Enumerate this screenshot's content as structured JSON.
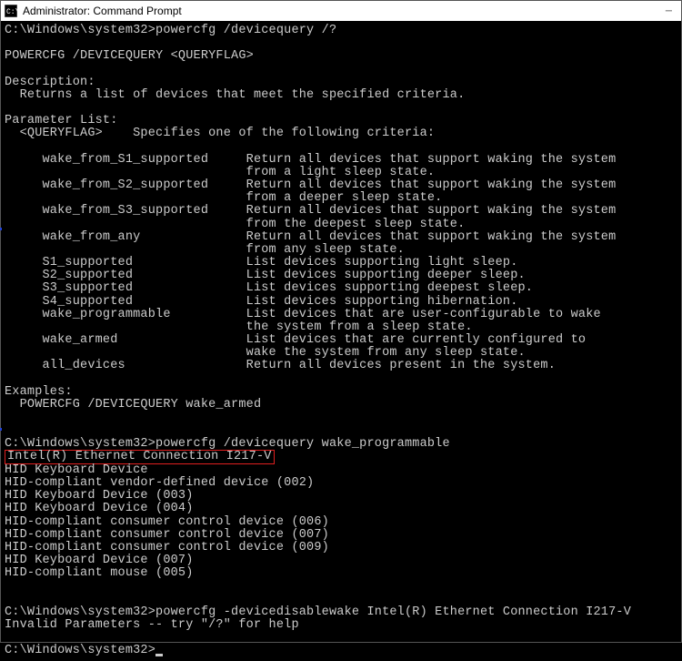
{
  "window": {
    "title": "Administrator: Command Prompt"
  },
  "terminal": {
    "prompt1_path": "C:\\Windows\\system32>",
    "prompt1_cmd": "powercfg /devicequery /?",
    "usage": "POWERCFG /DEVICEQUERY <QUERYFLAG>",
    "desc_header": "Description:",
    "desc_body": "  Returns a list of devices that meet the specified criteria.",
    "param_header": "Parameter List:",
    "param_intro": "  <QUERYFLAG>    Specifies one of the following criteria:",
    "flags": [
      {
        "name": "     wake_from_S1_supported",
        "desc1": "Return all devices that support waking the system",
        "desc2": "from a light sleep state."
      },
      {
        "name": "     wake_from_S2_supported",
        "desc1": "Return all devices that support waking the system",
        "desc2": "from a deeper sleep state."
      },
      {
        "name": "     wake_from_S3_supported",
        "desc1": "Return all devices that support waking the system",
        "desc2": "from the deepest sleep state."
      },
      {
        "name": "     wake_from_any",
        "desc1": "Return all devices that support waking the system",
        "desc2": "from any sleep state."
      },
      {
        "name": "     S1_supported",
        "desc1": "List devices supporting light sleep.",
        "desc2": ""
      },
      {
        "name": "     S2_supported",
        "desc1": "List devices supporting deeper sleep.",
        "desc2": ""
      },
      {
        "name": "     S3_supported",
        "desc1": "List devices supporting deepest sleep.",
        "desc2": ""
      },
      {
        "name": "     S4_supported",
        "desc1": "List devices supporting hibernation.",
        "desc2": ""
      },
      {
        "name": "     wake_programmable",
        "desc1": "List devices that are user-configurable to wake",
        "desc2": "the system from a sleep state."
      },
      {
        "name": "     wake_armed",
        "desc1": "List devices that are currently configured to",
        "desc2": "wake the system from any sleep state."
      },
      {
        "name": "     all_devices",
        "desc1": "Return all devices present in the system.",
        "desc2": ""
      }
    ],
    "examples_header": "Examples:",
    "examples_body": "  POWERCFG /DEVICEQUERY wake_armed",
    "prompt2_path": "C:\\Windows\\system32>",
    "prompt2_cmd": "powercfg /devicequery wake_programmable",
    "highlighted_device": "Intel(R) Ethernet Connection I217-V",
    "devices": [
      "HID Keyboard Device",
      "HID-compliant vendor-defined device (002)",
      "HID Keyboard Device (003)",
      "HID Keyboard Device (004)",
      "HID-compliant consumer control device (006)",
      "HID-compliant consumer control device (007)",
      "HID-compliant consumer control device (009)",
      "HID Keyboard Device (007)",
      "HID-compliant mouse (005)"
    ],
    "prompt3_path": "C:\\Windows\\system32>",
    "prompt3_cmd": "powercfg -devicedisablewake Intel(R) Ethernet Connection I217-V",
    "error": "Invalid Parameters -- try \"/?\" for help",
    "prompt4_path": "C:\\Windows\\system32>"
  }
}
